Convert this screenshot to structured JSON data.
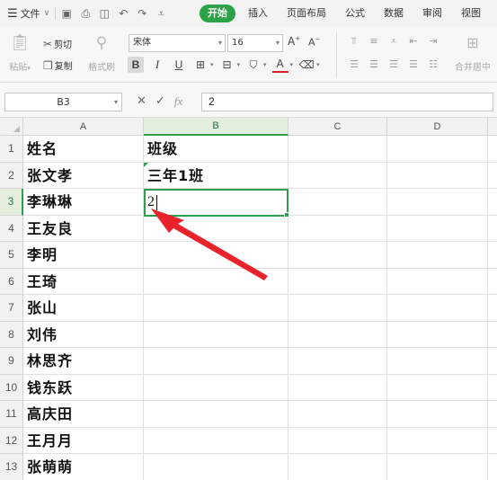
{
  "menubar": {
    "file_label": "文件",
    "tabs": [
      "开始",
      "插入",
      "页面布局",
      "公式",
      "数据",
      "审阅",
      "视图"
    ],
    "active_tab": "开始"
  },
  "ribbon": {
    "paste_label": "粘贴",
    "cut_label": "剪切",
    "copy_label": "复制",
    "format_painter_label": "格式刷",
    "font_name": "宋体",
    "font_size": "16",
    "bold": "B",
    "italic": "I",
    "underline": "U",
    "font_color_glyph": "A",
    "merge_label": "合并居中",
    "accent_color": "#2ba245"
  },
  "formula_bar": {
    "cell_ref": "B3",
    "fx_label": "fx",
    "content": "2"
  },
  "sheet": {
    "columns": [
      "A",
      "B",
      "C",
      "D"
    ],
    "active_column": "B",
    "active_row": 3,
    "rows": [
      {
        "num": "1",
        "a": "姓名",
        "b": "班级"
      },
      {
        "num": "2",
        "a": "张文孝",
        "b": "三年1班"
      },
      {
        "num": "3",
        "a": "李琳琳",
        "b": "2"
      },
      {
        "num": "4",
        "a": "王友良",
        "b": ""
      },
      {
        "num": "5",
        "a": "李明",
        "b": ""
      },
      {
        "num": "6",
        "a": "王琦",
        "b": ""
      },
      {
        "num": "7",
        "a": "张山",
        "b": ""
      },
      {
        "num": "8",
        "a": "刘伟",
        "b": ""
      },
      {
        "num": "9",
        "a": "林思齐",
        "b": ""
      },
      {
        "num": "10",
        "a": "钱东跃",
        "b": ""
      },
      {
        "num": "11",
        "a": "高庆田",
        "b": ""
      },
      {
        "num": "12",
        "a": "王月月",
        "b": ""
      },
      {
        "num": "13",
        "a": "张萌萌",
        "b": ""
      }
    ],
    "selection_color": "#2e9d4e",
    "annotation_arrow_color": "#e8232b"
  }
}
